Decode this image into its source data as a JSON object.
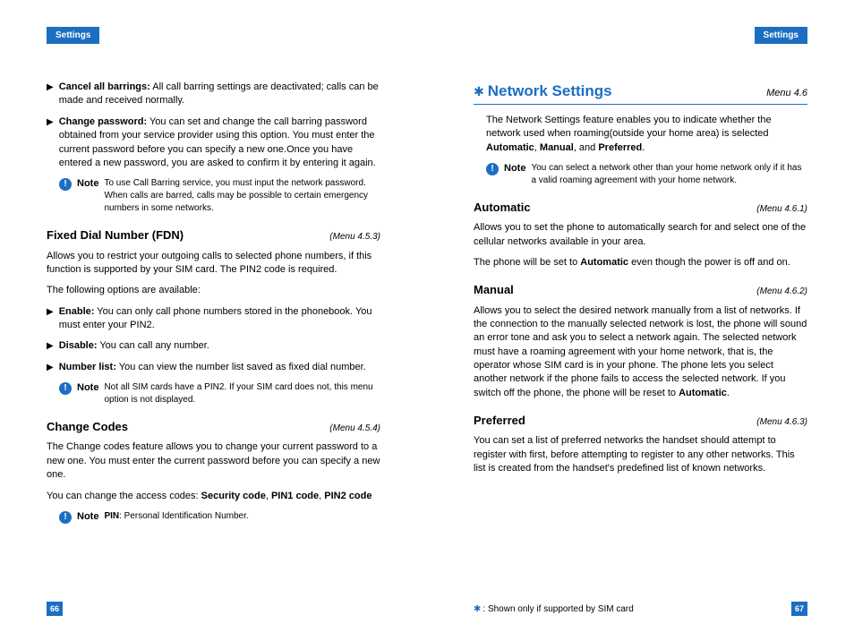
{
  "left": {
    "tab": "Settings",
    "bullets1": [
      {
        "label": "Cancel all barrings:",
        "text": " All call barring settings are deactivated; calls can be made and received normally."
      },
      {
        "label": "Change password:",
        "text": " You can set and change the call barring password obtained from your service provider using this option. You must enter the current password before you can specify a new one.Once you have entered a new password, you are asked to confirm it by entering it again."
      }
    ],
    "note1": {
      "label": "Note",
      "text": "To use Call Barring service, you must input the network password. When calls are barred, calls may be possible to certain emergency numbers in some networks."
    },
    "fdn": {
      "title": "Fixed Dial Number (FDN)",
      "menu": "(Menu 4.5.3)"
    },
    "fdn_p1": "Allows you to restrict your outgoing calls to selected phone numbers, if this function is supported by your SIM card. The PIN2 code is required.",
    "fdn_p2": "The following options are available:",
    "bullets2": [
      {
        "label": "Enable:",
        "text": " You can only call phone numbers stored in the phonebook. You must enter your PIN2."
      },
      {
        "label": "Disable:",
        "text": " You can call any number."
      },
      {
        "label": "Number list:",
        "text": " You can view the number list saved as fixed dial number."
      }
    ],
    "note2": {
      "label": "Note",
      "text": "Not all SIM cards have a PIN2. If your SIM card does not, this menu option is not displayed."
    },
    "codes": {
      "title": "Change Codes",
      "menu": "(Menu 4.5.4)"
    },
    "codes_p1": "The Change codes feature allows you to change your current password to a new one. You must enter the current password before you can specify a new one.",
    "codes_p2a": "You can change the access codes: ",
    "codes_p2b": "Security code",
    "codes_p2c": ", ",
    "codes_p2d": "PIN1 code",
    "codes_p2e": ", ",
    "codes_p2f": "PIN2 code",
    "note3": {
      "label": "Note",
      "pinlabel": "PIN",
      "text": ": Personal Identification Number."
    },
    "pagenum": "66"
  },
  "right": {
    "tab": "Settings",
    "section": {
      "title": "Network Settings",
      "menu": "Menu 4.6"
    },
    "intro_a": "The Network Settings feature enables you to indicate whether the network used when roaming(outside your home area) is selected ",
    "intro_b1": "Automatic",
    "intro_c1": ", ",
    "intro_b2": "Manual",
    "intro_c2": ", and ",
    "intro_b3": "Preferred",
    "intro_c3": ".",
    "note4": {
      "label": "Note",
      "text": "You can select a network other than your home network only if it has a valid roaming agreement with your home network."
    },
    "auto": {
      "title": "Automatic",
      "menu": "(Menu 4.6.1)"
    },
    "auto_p1": "Allows you to set the phone to automatically search for and select one of the cellular networks available in your area.",
    "auto_p2a": "The phone will be set to ",
    "auto_p2b": "Automatic",
    "auto_p2c": " even though the power is off and on.",
    "manual": {
      "title": "Manual",
      "menu": "(Menu 4.6.2)"
    },
    "manual_p_a": "Allows you to select the desired network manually from a list of networks. If the connection to the manually selected network is lost, the phone will sound an error tone and ask you to select a network again. The selected network must have a roaming agreement with your home network, that is, the operator whose SIM card is in your phone. The phone lets you select another network if the phone fails to access the selected network. If you switch off the phone, the phone will be reset to ",
    "manual_p_b": "Automatic",
    "manual_p_c": ".",
    "pref": {
      "title": "Preferred",
      "menu": "(Menu 4.6.3)"
    },
    "pref_p": "You can set a list of preferred networks the handset should attempt to register with first, before attempting to register to any other networks. This list is created from the handset's predefined list of known networks.",
    "footnote": ": Shown only if supported by SIM card",
    "pagenum": "67"
  }
}
